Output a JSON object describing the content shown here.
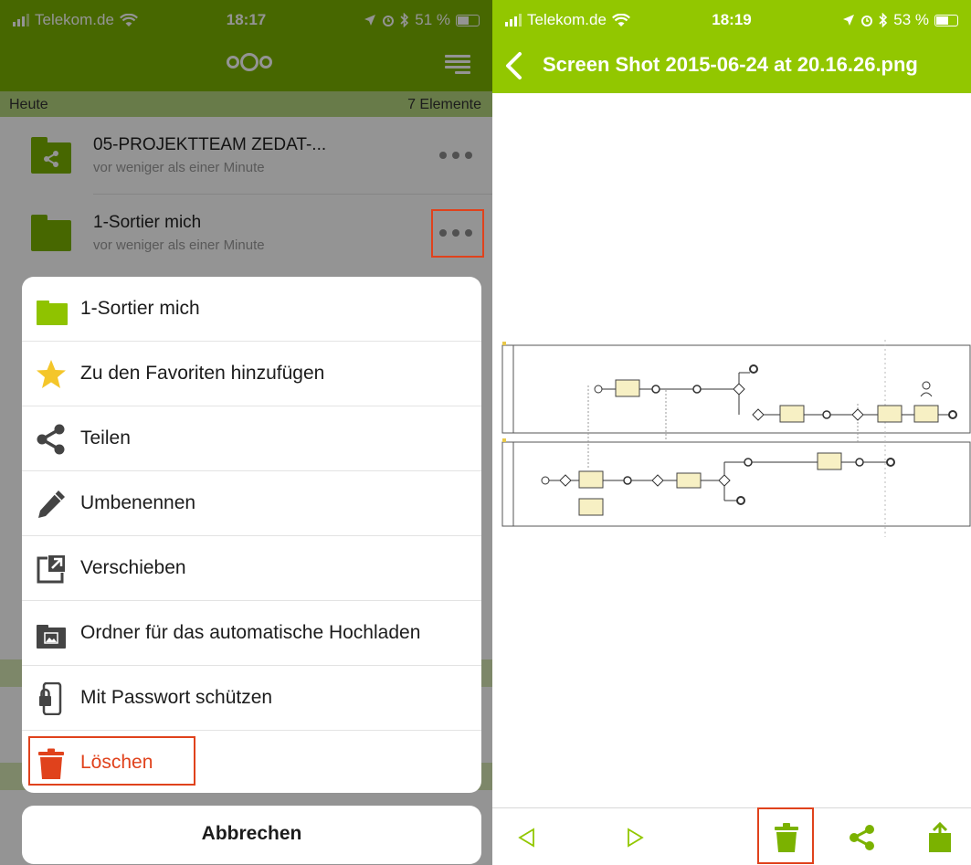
{
  "colors": {
    "brand_green": "#7bb200",
    "brand_light_green": "#92c700",
    "delete_red": "#e0421c",
    "star_yellow": "#f4c62a",
    "icon_gray": "#444444"
  },
  "left_screen": {
    "status": {
      "carrier": "Telekom.de",
      "time": "18:17",
      "battery": "51 %",
      "battery_level": 0.51
    },
    "header": {
      "logo_icon": "nextcloud-logo",
      "menu_icon": "hamburger-menu-icon"
    },
    "section": {
      "label": "Heute",
      "count": "7 Elemente"
    },
    "files": [
      {
        "name": "05-PROJEKTTEAM ZEDAT-...",
        "subtitle": "vor weniger als einer Minute",
        "icon": "shared-folder-icon"
      },
      {
        "name": "1-Sortier mich",
        "subtitle": "vor weniger als einer Minute",
        "icon": "folder-icon"
      }
    ],
    "action_sheet": {
      "items": [
        {
          "label": "1-Sortier mich",
          "icon": "folder-icon"
        },
        {
          "label": "Zu den Favoriten hinzufügen",
          "icon": "star-icon"
        },
        {
          "label": "Teilen",
          "icon": "share-icon"
        },
        {
          "label": "Umbenennen",
          "icon": "pencil-icon"
        },
        {
          "label": "Verschieben",
          "icon": "move-icon"
        },
        {
          "label": "Ordner für das automatische Hochladen",
          "icon": "photo-folder-icon"
        },
        {
          "label": "Mit Passwort schützen",
          "icon": "phone-lock-icon"
        },
        {
          "label": "Löschen",
          "icon": "trash-icon"
        }
      ],
      "cancel": "Abbrechen"
    }
  },
  "right_screen": {
    "status": {
      "carrier": "Telekom.de",
      "time": "18:19",
      "battery": "53 %",
      "battery_level": 0.53
    },
    "title": "Screen Shot 2015-06-24 at 20.16.26.png",
    "toolbar": [
      "previous-icon",
      "next-icon",
      "trash-icon",
      "share-icon",
      "export-icon"
    ]
  }
}
